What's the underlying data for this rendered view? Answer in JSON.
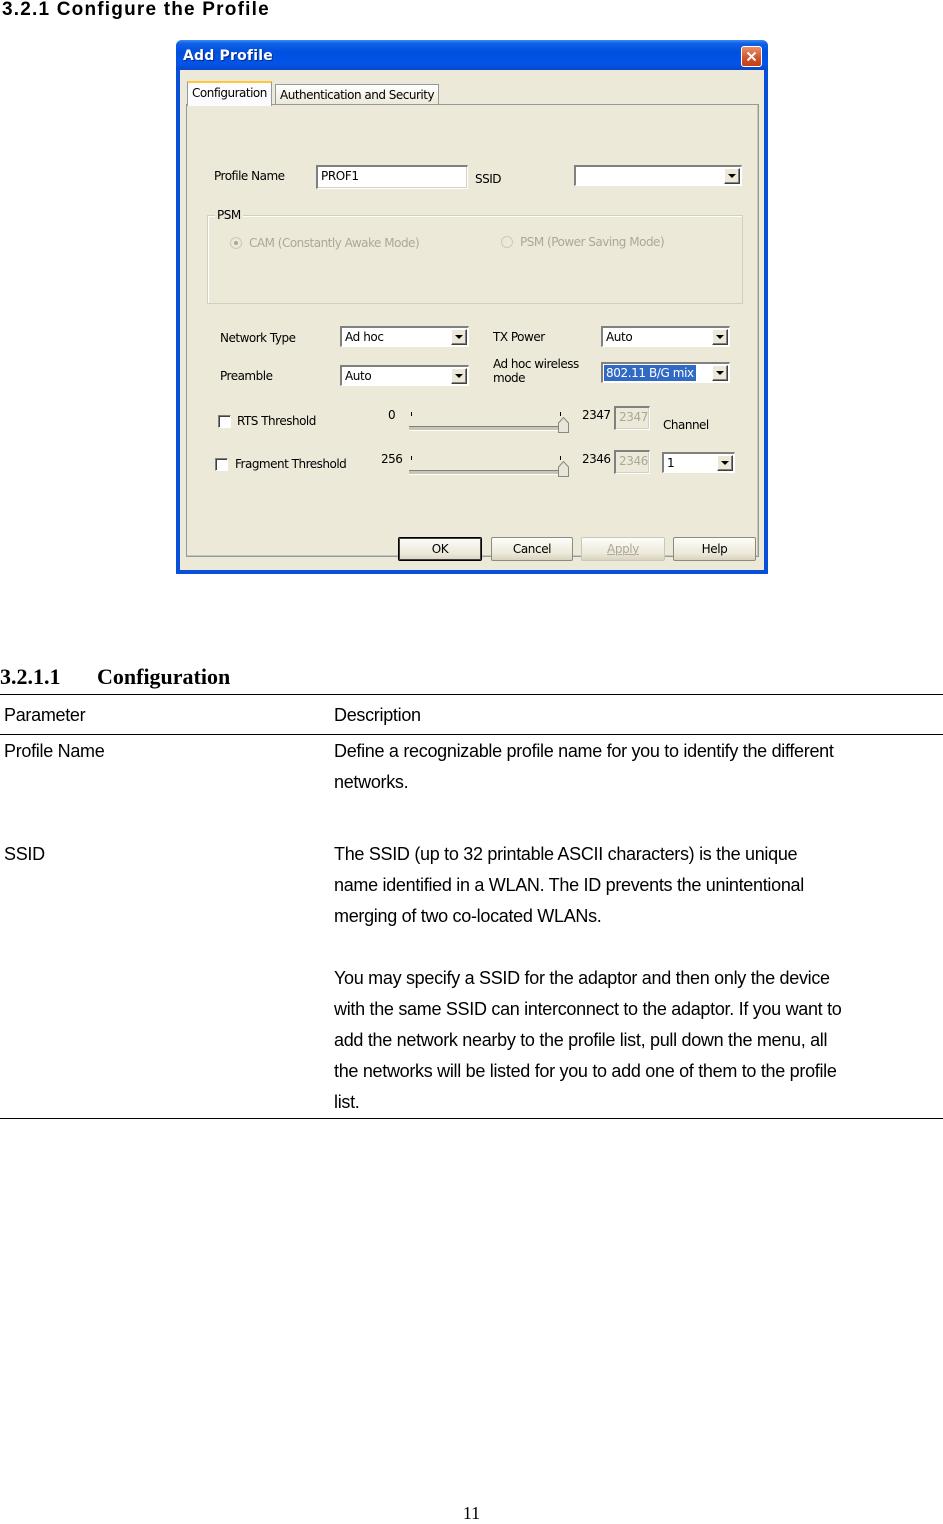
{
  "section_heading": "3.2.1   Configure the Profile",
  "dialog": {
    "title": "Add Profile",
    "tabs": [
      {
        "label": "Configuration",
        "active": true
      },
      {
        "label": "Authentication and Security",
        "active": false
      }
    ],
    "profile_name": {
      "label": "Profile Name",
      "value": "PROF1"
    },
    "ssid": {
      "label": "SSID",
      "value": ""
    },
    "psm": {
      "group_label": "PSM",
      "options": [
        {
          "label": "CAM (Constantly Awake Mode)",
          "selected": true,
          "enabled": false
        },
        {
          "label": "PSM (Power Saving Mode)",
          "selected": false,
          "enabled": false
        }
      ]
    },
    "network_type": {
      "label": "Network Type",
      "value": "Ad hoc"
    },
    "preamble": {
      "label": "Preamble",
      "value": "Auto"
    },
    "tx_power": {
      "label": "TX Power",
      "value": "Auto"
    },
    "adhoc_mode": {
      "label_line1": "Ad hoc wireless",
      "label_line2": "mode",
      "value": "802.11 B/G mix"
    },
    "rts": {
      "label": "RTS Threshold",
      "checked": false,
      "min": "0",
      "max": "2347",
      "value": "2347",
      "position": 1.0
    },
    "fragment": {
      "label": "Fragment Threshold",
      "checked": false,
      "min": "256",
      "max": "2346",
      "value": "2346",
      "position": 1.0
    },
    "channel": {
      "label": "Channel",
      "value": "1"
    },
    "buttons": {
      "ok": "OK",
      "cancel": "Cancel",
      "apply": "Apply",
      "help": "Help"
    },
    "colors": {
      "titlebar": "#0054e3",
      "client": "#ece9d8",
      "selection": "#316ac5",
      "close": "#d2502a"
    }
  },
  "subsection": {
    "number": "3.2.1.1",
    "title": "Configuration"
  },
  "table": {
    "headers": {
      "param": "Parameter",
      "desc": "Description"
    },
    "rows": [
      {
        "param": "Profile Name",
        "desc": [
          "Define a recognizable profile name for you to identify the different",
          "networks."
        ]
      },
      {
        "param": "SSID",
        "desc": [
          "The SSID (up to 32 printable ASCII characters) is the unique",
          "name identified in a WLAN. The ID prevents the unintentional",
          "merging of two co-located WLANs.",
          "",
          "You may specify a SSID for the adaptor and then only the device",
          "with the same SSID can interconnect to the adaptor. If you want to",
          "add the network nearby to the profile list, pull down the menu, all",
          "the networks will be listed for you to add one of them to the profile",
          "list."
        ]
      }
    ]
  },
  "page_number": "11"
}
